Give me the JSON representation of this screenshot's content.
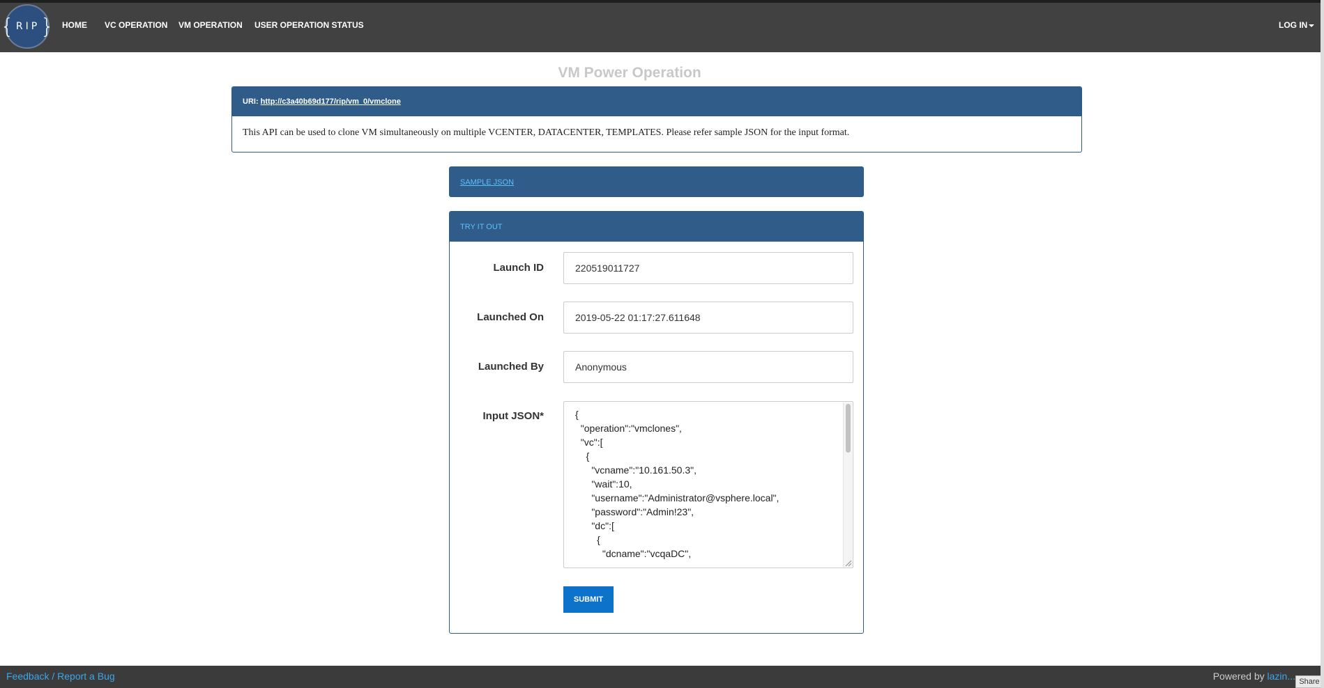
{
  "nav": {
    "logo_left": "{",
    "logo_text": "RIP",
    "logo_right": "}",
    "items": [
      "HOME",
      "VC OPERATION",
      "VM OPERATION",
      "USER OPERATION STATUS"
    ],
    "login": "LOG IN"
  },
  "page_title": "VM Power Operation",
  "uri": {
    "label": "URI:",
    "link": "http://c3a40b69d177/rip/vm_0/vmclone",
    "description": "This API can be used to clone VM simultaneously on multiple VCENTER, DATACENTER, TEMPLATES. Please refer sample JSON for the input format."
  },
  "sample_json": {
    "label": "SAMPLE JSON"
  },
  "try_it_out": {
    "title": "TRY IT OUT",
    "launch_id": {
      "label": "Launch ID",
      "value": "220519011727"
    },
    "launched_on": {
      "label": "Launched On",
      "value": "2019-05-22 01:17:27.611648"
    },
    "launched_by": {
      "label": "Launched By",
      "value": "Anonymous"
    },
    "input_json": {
      "label": "Input JSON*",
      "value": "{\n  \"operation\":\"vmclones\",\n  \"vc\":[\n    {\n      \"vcname\":\"10.161.50.3\",\n      \"wait\":10,\n      \"username\":\"Administrator@vsphere.local\",\n      \"password\":\"Admin!23\",\n      \"dc\":[\n        {\n          \"dcname\":\"vcqaDC\","
    },
    "submit_label": "SUBMIT"
  },
  "footer": {
    "feedback": "Feedback / Report a Bug",
    "powered_by": "Powered by",
    "powered_link": "lazin...",
    "share": "Share"
  },
  "colors": {
    "navbar": "#414141",
    "panel_header": "#305c89",
    "submit": "#0d72c9",
    "link": "#3ea6e8"
  }
}
